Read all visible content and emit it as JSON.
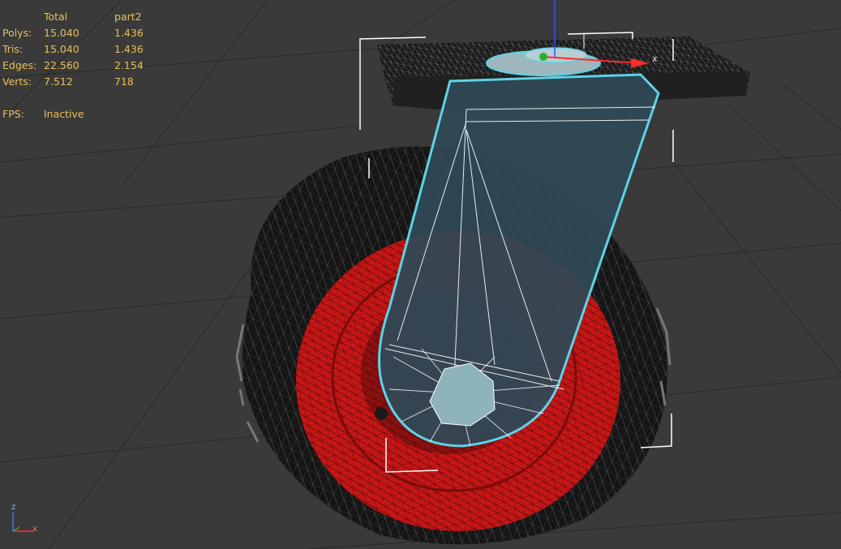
{
  "viewport": {
    "stats": {
      "header": {
        "total": "Total",
        "object": "part2"
      },
      "rows": [
        {
          "label": "Polys:",
          "total": "15.040",
          "object": "1.436"
        },
        {
          "label": "Tris:",
          "total": "15.040",
          "object": "1.436"
        },
        {
          "label": "Edges:",
          "total": "22.560",
          "object": "2.154"
        },
        {
          "label": "Verts:",
          "total": "7.512",
          "object": "718"
        }
      ],
      "fps": {
        "label": "FPS:",
        "value": "Inactive"
      }
    },
    "axis_tripod": {
      "z_label": "z",
      "x_label": "x"
    },
    "gizmo": {
      "x_label": "x"
    }
  },
  "colors": {
    "background": "#3a3a3a",
    "grid_line": "#2a2a2a",
    "stats_text": "#e8c05a",
    "selection_outline": "#5fd2e6",
    "fork_fill": "#2f4a57",
    "rim_red": "#c81616",
    "tire_dark": "#121212",
    "bounding_box": "#ffffff"
  }
}
